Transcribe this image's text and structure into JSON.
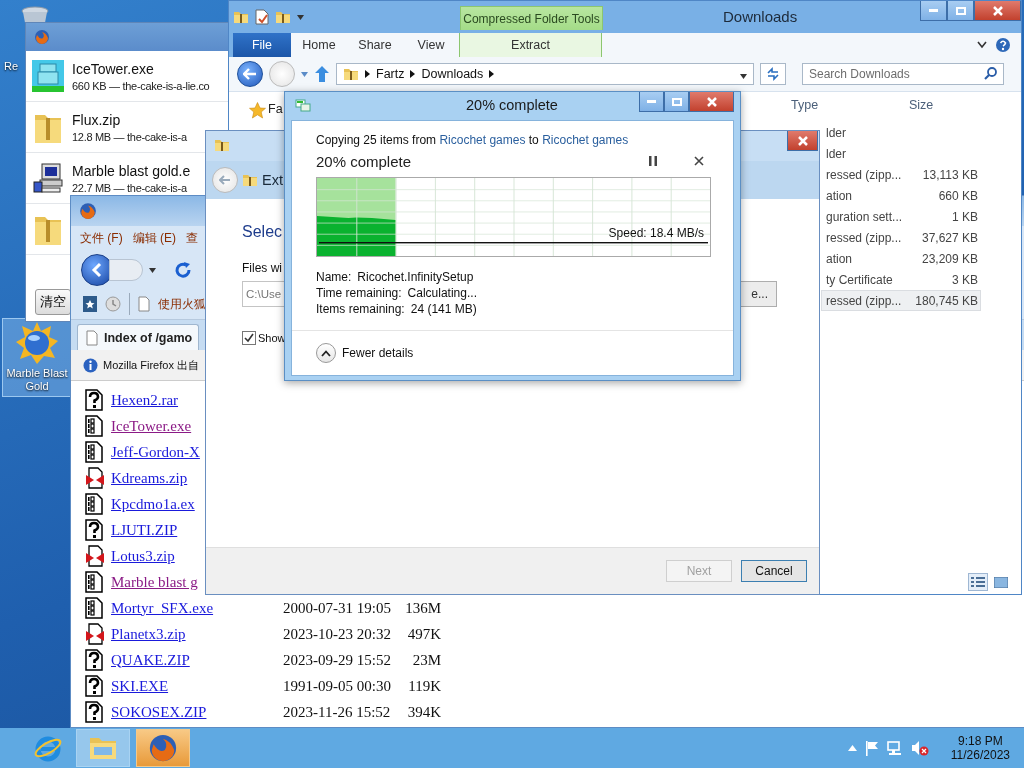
{
  "desktop": {
    "icons": [
      {
        "kind": "bin",
        "label": "Re",
        "selected": false
      },
      {
        "kind": "marble",
        "label": "Marble Blast Gold",
        "selected": true
      }
    ]
  },
  "downloads_panel": {
    "items": [
      {
        "kind": "tower",
        "name": "IceTower.exe",
        "detail": "660 KB — the-cake-is-a-lie.co"
      },
      {
        "kind": "zip",
        "name": "Flux.zip",
        "detail": "12.8 MB — the-cake-is-a"
      },
      {
        "kind": "installer",
        "name": "Marble blast gold.e",
        "detail": "22.7 MB — the-cake-is-a"
      },
      {
        "kind": "zip"
      }
    ],
    "clear_button": "清空"
  },
  "explorer": {
    "title": "Downloads",
    "context_label": "Compressed Folder Tools",
    "tabs": [
      {
        "label": "File",
        "selected": true,
        "kind": "file"
      },
      {
        "label": "Home",
        "selected": false,
        "kind": "normal"
      },
      {
        "label": "Share",
        "selected": false,
        "kind": "normal"
      },
      {
        "label": "View",
        "selected": false,
        "kind": "normal"
      },
      {
        "label": "Extract",
        "selected": false,
        "kind": "context"
      }
    ],
    "path": [
      "Fartz",
      "Downloads"
    ],
    "search": {
      "placeholder": "Search Downloads"
    },
    "nav_item": "Fa",
    "columns": [
      "Type",
      "Size"
    ],
    "rows": [
      {
        "type": "lder",
        "selected": false
      },
      {
        "type": "lder",
        "selected": false
      },
      {
        "type": "ressed (zipp...",
        "size": "13,113 KB",
        "selected": false
      },
      {
        "type": "ation",
        "size": "660 KB",
        "selected": false
      },
      {
        "type": "guration sett...",
        "size": "1 KB",
        "selected": false
      },
      {
        "type": "ressed (zipp...",
        "size": "37,627 KB",
        "selected": false
      },
      {
        "type": "ation",
        "size": "23,209 KB",
        "selected": false
      },
      {
        "type": "ty Certificate",
        "size": "3 KB",
        "selected": false
      },
      {
        "type": "ressed (zipp...",
        "size": "180,745 KB",
        "selected": true
      }
    ]
  },
  "browser": {
    "menu": [
      "文件 (F)",
      "编辑 (E)",
      "查"
    ],
    "bookmark": "使用火狐",
    "tab": "Index of /gamo",
    "notice": "Mozilla Firefox 出自",
    "files": [
      {
        "kind": "unknown",
        "name": "Hexen2.rar",
        "visited": false
      },
      {
        "kind": "binary",
        "name": "IceTower.exe",
        "visited": true
      },
      {
        "kind": "binary",
        "name": "Jeff-Gordon-X",
        "visited": false
      },
      {
        "kind": "zip",
        "name": "Kdreams.zip",
        "visited": false
      },
      {
        "kind": "binary",
        "name": "Kpcdmo1a.ex",
        "visited": false
      },
      {
        "kind": "unknown",
        "name": "LJUTI.ZIP",
        "visited": false
      },
      {
        "kind": "zip",
        "name": "Lotus3.zip",
        "visited": false
      },
      {
        "kind": "binary",
        "name": "Marble blast g",
        "visited": true
      },
      {
        "kind": "binary",
        "name": "Mortyr_SFX.exe",
        "visited": false,
        "date": "2000-07-31 19:05",
        "size": "136M"
      },
      {
        "kind": "zip",
        "name": "Planetx3.zip",
        "visited": false,
        "date": "2023-10-23 20:32",
        "size": "497K"
      },
      {
        "kind": "unknown",
        "name": "QUAKE.ZIP",
        "visited": false,
        "date": "2023-09-29 15:52",
        "size": "23M"
      },
      {
        "kind": "unknown",
        "name": "SKI.EXE",
        "visited": false,
        "date": "1991-09-05 00:30",
        "size": "119K"
      },
      {
        "kind": "unknown",
        "name": "SOKOSEX.ZIP",
        "visited": false,
        "date": "2023-11-26 15:52",
        "size": "394K"
      }
    ]
  },
  "extract_dialog": {
    "title": "Ext",
    "heading": "Selec",
    "field_label": "Files wi",
    "path": "C:\\Use",
    "browse": "e...",
    "checkbox": {
      "label": "Show",
      "checked": true
    },
    "buttons": [
      {
        "label": "Next",
        "disabled": true
      },
      {
        "label": "Cancel",
        "disabled": false
      }
    ]
  },
  "copy_dialog": {
    "title": "20% complete",
    "summary": {
      "prefix": "Copying 25 items from",
      "source": "Ricochet games",
      "joiner": "to",
      "destination": "Ricochet games"
    },
    "heading": "20% complete",
    "level": 0.2,
    "speed": "Speed: 18.4 MB/s",
    "details": [
      {
        "label": "Name:",
        "value": "Ricochet.InfinitySetup"
      },
      {
        "label": "Time remaining:",
        "value": "Calculating..."
      },
      {
        "label": "Items remaining:",
        "value": "24 (141 MB)"
      }
    ],
    "toggle": "Fewer details"
  },
  "taskbar": {
    "apps": [
      {
        "kind": "ie",
        "selected": false
      },
      {
        "kind": "explorer",
        "selected": false
      },
      {
        "kind": "firefox",
        "selected": true
      }
    ],
    "time": "9:18 PM",
    "date": "11/26/2023"
  }
}
